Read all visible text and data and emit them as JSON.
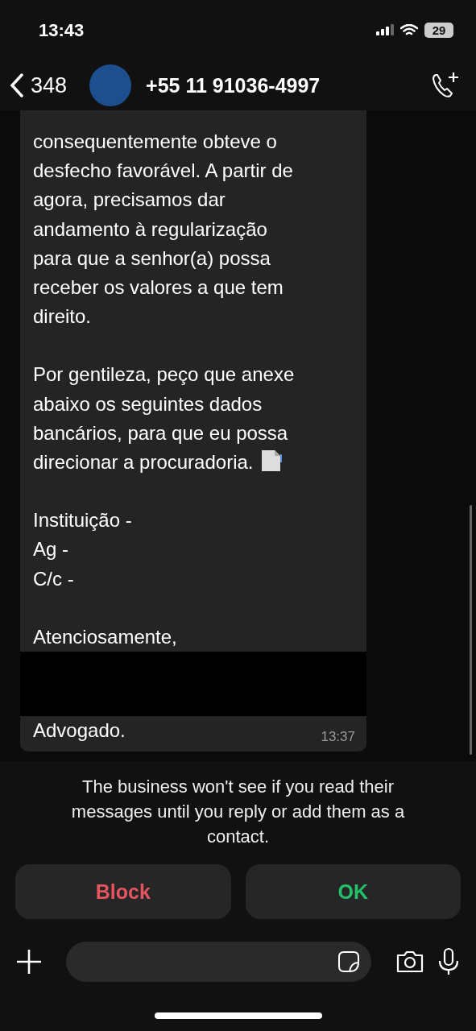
{
  "status_bar": {
    "time": "13:43",
    "battery": "29"
  },
  "header": {
    "back_count": "348",
    "contact": "+55 11 91036-4997"
  },
  "message": {
    "paragraphs": [
      "consequentemente obteve o\ndesfecho favorável. A partir de\nagora, precisamos dar\nandamento à regularização\npara que a senhor(a) possa\nreceber os valores a que tem\ndireito.",
      "Por gentileza, peço que anexe\nabaixo os seguintes dados\nbancários, para que eu possa\ndirecionar a procuradoria.",
      "Instituição -\nAg -\nC/c -",
      "Atenciosamente,"
    ],
    "closing": "Advogado.",
    "time": "13:37"
  },
  "notice": "The business won't see if you read their messages until you reply or add them as a contact.",
  "actions": [
    {
      "label": "Block",
      "kind": "danger"
    },
    {
      "label": "OK",
      "kind": "confirm"
    }
  ]
}
